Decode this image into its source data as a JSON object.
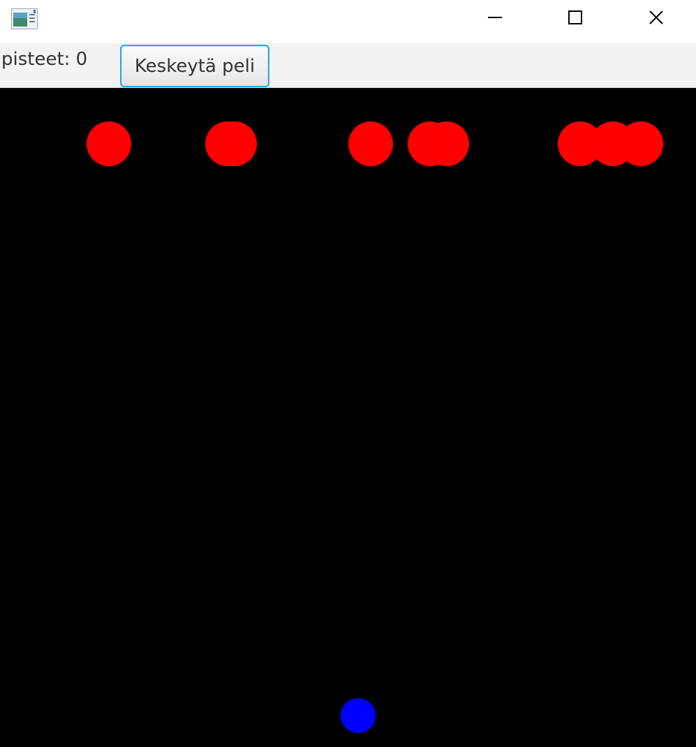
{
  "window": {
    "app_icon": "java-app-icon",
    "controls": {
      "minimize_icon": "minimize-icon",
      "maximize_icon": "maximize-icon",
      "close_icon": "close-icon"
    }
  },
  "toolbar": {
    "score_label": "pisteet: 0",
    "pause_button_label": "Keskeytä peli"
  },
  "game": {
    "background_color": "#000000",
    "enemy_color": "#ff0000",
    "player_color": "#0000ff"
  }
}
